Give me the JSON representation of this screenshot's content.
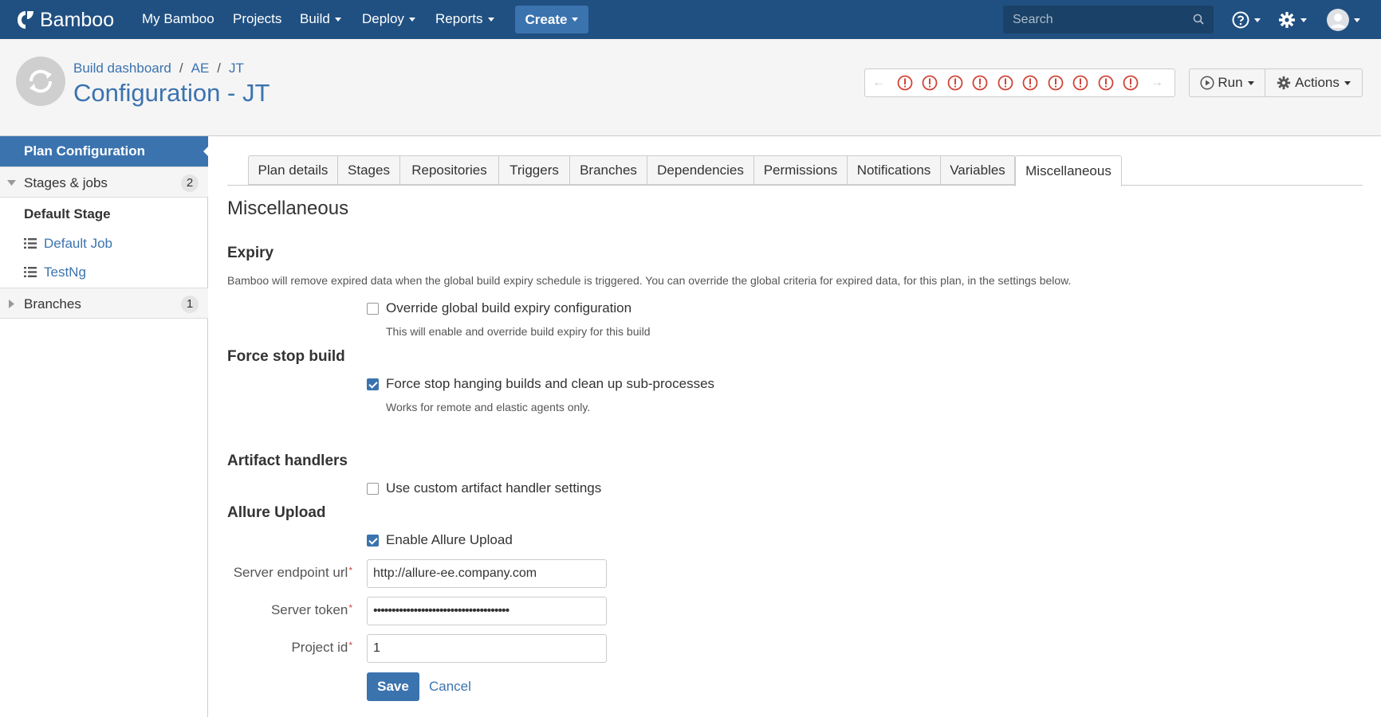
{
  "app": {
    "logo_text": "Bamboo",
    "accent_color": "#205081",
    "link_color": "#3b73af",
    "error_color": "#d04437"
  },
  "topnav": {
    "items": [
      {
        "label": "My Bamboo",
        "dropdown": false
      },
      {
        "label": "Projects",
        "dropdown": false
      },
      {
        "label": "Build",
        "dropdown": true
      },
      {
        "label": "Deploy",
        "dropdown": true
      },
      {
        "label": "Reports",
        "dropdown": true
      }
    ],
    "create_label": "Create",
    "search_placeholder": "Search",
    "icons": [
      "help-icon",
      "settings-gear-icon",
      "user-avatar-icon"
    ]
  },
  "header": {
    "breadcrumbs": [
      "Build dashboard",
      "AE",
      "JT"
    ],
    "title": "Configuration - JT",
    "build_history_icons": [
      "failed-build-icon",
      "failed-build-icon",
      "failed-build-icon",
      "failed-build-icon",
      "failed-build-icon",
      "failed-build-icon",
      "failed-build-icon",
      "failed-build-icon",
      "failed-build-icon",
      "failed-build-icon"
    ],
    "run_label": "Run",
    "actions_label": "Actions"
  },
  "sidebar": {
    "active_label": "Plan Configuration",
    "stages_label": "Stages & jobs",
    "stages_count": "2",
    "stage_name": "Default Stage",
    "jobs": [
      "Default Job",
      "TestNg"
    ],
    "branches_label": "Branches",
    "branches_count": "1"
  },
  "tabs": {
    "items": [
      "Plan details",
      "Stages",
      "Repositories",
      "Triggers",
      "Branches",
      "Dependencies",
      "Permissions",
      "Notifications",
      "Variables",
      "Miscellaneous"
    ],
    "active": "Miscellaneous"
  },
  "main": {
    "title": "Miscellaneous",
    "expiry": {
      "heading": "Expiry",
      "description": "Bamboo will remove expired data when the global build expiry schedule is triggered. You can override the global criteria for expired data, for this plan, in the settings below.",
      "override_label": "Override global build expiry configuration",
      "override_checked": false,
      "override_help": "This will enable and override build expiry for this build"
    },
    "force_stop": {
      "heading": "Force stop build",
      "label": "Force stop hanging builds and clean up sub-processes",
      "checked": true,
      "help": "Works for remote and elastic agents only."
    },
    "artifact": {
      "heading": "Artifact handlers",
      "label": "Use custom artifact handler settings",
      "checked": false
    },
    "allure": {
      "heading": "Allure Upload",
      "enable_label": "Enable Allure Upload",
      "enable_checked": true,
      "endpoint_label": "Server endpoint url",
      "endpoint_value": "http://allure-ee.company.com",
      "token_label": "Server token",
      "token_value": "•••••••••••••••••••••••••••••••••••••",
      "project_label": "Project id",
      "project_value": "1",
      "required_mark": "*"
    },
    "save_label": "Save",
    "cancel_label": "Cancel"
  }
}
